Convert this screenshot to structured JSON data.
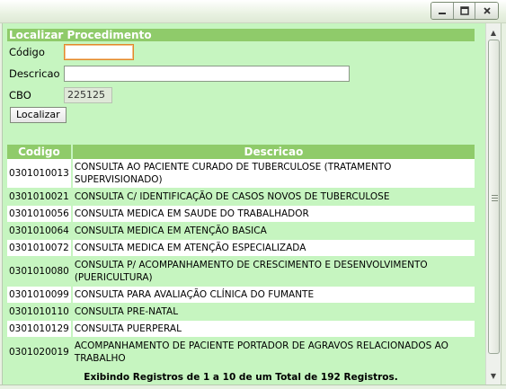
{
  "window": {
    "controls": {
      "minimize_icon": "minimize-icon",
      "maximize_icon": "maximize-icon",
      "close_icon": "close-icon"
    }
  },
  "search": {
    "title": "Localizar Procedimento",
    "codigo_label": "Código",
    "codigo_value": "",
    "descricao_label": "Descricao",
    "descricao_value": "",
    "cbo_label": "CBO",
    "cbo_value": "225125",
    "submit_label": "Localizar"
  },
  "results": {
    "columns": [
      "Codigo",
      "Descricao"
    ],
    "rows": [
      {
        "codigo": "0301010013",
        "descricao": "CONSULTA AO PACIENTE CURADO DE TUBERCULOSE (TRATAMENTO SUPERVISIONADO)"
      },
      {
        "codigo": "0301010021",
        "descricao": "CONSULTA C/ IDENTIFICAÇÃO DE CASOS NOVOS DE TUBERCULOSE"
      },
      {
        "codigo": "0301010056",
        "descricao": "CONSULTA MEDICA EM SAUDE DO TRABALHADOR"
      },
      {
        "codigo": "0301010064",
        "descricao": "CONSULTA MEDICA EM ATENÇÃO BASICA"
      },
      {
        "codigo": "0301010072",
        "descricao": "CONSULTA MEDICA EM ATENÇÃO ESPECIALIZADA"
      },
      {
        "codigo": "0301010080",
        "descricao": "CONSULTA P/ ACOMPANHAMENTO DE CRESCIMENTO E DESENVOLVIMENTO (PUERICULTURA)"
      },
      {
        "codigo": "0301010099",
        "descricao": "CONSULTA PARA AVALIAÇÃO CLÍNICA DO FUMANTE"
      },
      {
        "codigo": "0301010110",
        "descricao": "CONSULTA PRE-NATAL"
      },
      {
        "codigo": "0301010129",
        "descricao": "CONSULTA PUERPERAL"
      },
      {
        "codigo": "0301020019",
        "descricao": "ACOMPANHAMENTO DE PACIENTE PORTADOR DE AGRAVOS RELACIONADOS AO TRABALHO"
      }
    ],
    "footer": "Exibindo Registros de 1 a 10 de um Total de 192 Registros."
  },
  "colors": {
    "panel_bg": "#c6f5c0",
    "header_bg": "#8fcb6a",
    "focus_border": "#e2882a"
  }
}
